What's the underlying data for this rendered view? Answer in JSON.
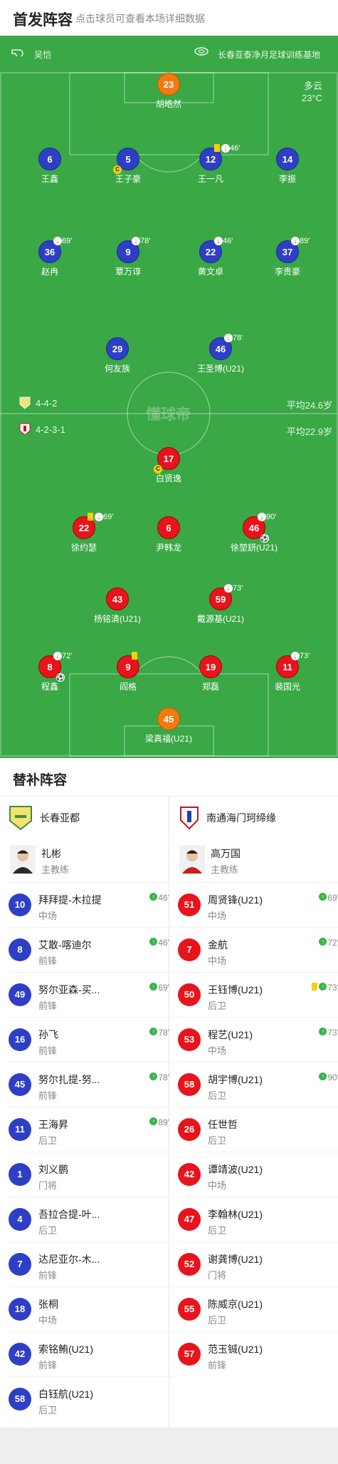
{
  "header": {
    "title": "首发阵容",
    "subtitle": "点击球员可查看本场详细数据"
  },
  "match_info": {
    "referee": "吴恺",
    "venue": "长春亚泰净月足球训练基地",
    "weather": "多云",
    "temperature": "23°C"
  },
  "watermark": "懂球帝",
  "home_formation": {
    "label": "4-4-2",
    "avg_age": "平均24.6岁"
  },
  "away_formation": {
    "label": "4-2-3-1",
    "avg_age": "平均22.9岁"
  },
  "home_lineup": [
    {
      "num": "23",
      "name": "胡皓然",
      "gk": true
    },
    {
      "num": "6",
      "name": "王鑫"
    },
    {
      "num": "5",
      "name": "王子豪",
      "captain": true
    },
    {
      "num": "12",
      "name": "王一凡",
      "yellow": true,
      "sub_out": "46'"
    },
    {
      "num": "14",
      "name": "李振"
    },
    {
      "num": "36",
      "name": "赵冉",
      "sub_out": "69'"
    },
    {
      "num": "9",
      "name": "覃万谆",
      "sub_out": "78'"
    },
    {
      "num": "22",
      "name": "黄文卓",
      "sub_out": "46'"
    },
    {
      "num": "37",
      "name": "李贵豪",
      "sub_out": "89'"
    },
    {
      "num": "29",
      "name": "何友族"
    },
    {
      "num": "46",
      "name": "王圣博(U21)",
      "sub_out": "78'"
    }
  ],
  "away_lineup": [
    {
      "num": "17",
      "name": "白贤逸",
      "captain": true
    },
    {
      "num": "22",
      "name": "徐约瑟",
      "yellow": true,
      "sub_out": "69'"
    },
    {
      "num": "6",
      "name": "尹韩龙"
    },
    {
      "num": "46",
      "name": "徐堃鈃(U21)",
      "sub_out": "90'",
      "goal": true
    },
    {
      "num": "43",
      "name": "杨铭清(U21)"
    },
    {
      "num": "59",
      "name": "戴源基(U21)",
      "sub_out": "73'"
    },
    {
      "num": "8",
      "name": "程鑫",
      "sub_out": "72'",
      "goal": true
    },
    {
      "num": "9",
      "name": "阎格",
      "yellow": true
    },
    {
      "num": "19",
      "name": "郑磊"
    },
    {
      "num": "11",
      "name": "裴国光",
      "sub_out": "73'"
    },
    {
      "num": "45",
      "name": "梁真福(U21)",
      "gk": true
    }
  ],
  "subs_title": "替补阵容",
  "home_team": {
    "name": "长春亚都",
    "coach": "礼彬",
    "coach_role": "主教练"
  },
  "away_team": {
    "name": "南通海门珂缔缘",
    "coach": "高万国",
    "coach_role": "主教练"
  },
  "home_subs": [
    {
      "num": "10",
      "name": "拜拜提-木拉提",
      "pos": "中场",
      "in": "46'"
    },
    {
      "num": "8",
      "name": "艾散-喀迪尔",
      "pos": "前锋",
      "in": "46'"
    },
    {
      "num": "49",
      "name": "努尔亚森-买...",
      "pos": "前锋",
      "in": "69'"
    },
    {
      "num": "16",
      "name": "孙飞",
      "pos": "前锋",
      "in": "78'"
    },
    {
      "num": "45",
      "name": "努尔扎提-努...",
      "pos": "前锋",
      "in": "78'"
    },
    {
      "num": "11",
      "name": "王海昇",
      "pos": "后卫",
      "in": "89'"
    },
    {
      "num": "1",
      "name": "刘义鹏",
      "pos": "门将"
    },
    {
      "num": "4",
      "name": "吾拉合提-叶...",
      "pos": "后卫"
    },
    {
      "num": "7",
      "name": "达尼亚尔-木...",
      "pos": "前锋"
    },
    {
      "num": "18",
      "name": "张桐",
      "pos": "中场"
    },
    {
      "num": "42",
      "name": "索铭鲔(U21)",
      "pos": "前锋"
    },
    {
      "num": "58",
      "name": "白钰航(U21)",
      "pos": "后卫"
    }
  ],
  "away_subs": [
    {
      "num": "51",
      "name": "周贤锋(U21)",
      "pos": "中场",
      "in": "69'"
    },
    {
      "num": "7",
      "name": "金航",
      "pos": "中场",
      "in": "72'"
    },
    {
      "num": "50",
      "name": "王钰博(U21)",
      "pos": "后卫",
      "in": "73'",
      "yellow": true
    },
    {
      "num": "53",
      "name": "程艺(U21)",
      "pos": "中场",
      "in": "73'"
    },
    {
      "num": "58",
      "name": "胡宇博(U21)",
      "pos": "后卫",
      "in": "90'"
    },
    {
      "num": "26",
      "name": "任世哲",
      "pos": "后卫"
    },
    {
      "num": "42",
      "name": "谭靖波(U21)",
      "pos": "中场"
    },
    {
      "num": "47",
      "name": "李翰林(U21)",
      "pos": "后卫"
    },
    {
      "num": "52",
      "name": "谢龚博(U21)",
      "pos": "门将"
    },
    {
      "num": "55",
      "name": "陈威京(U21)",
      "pos": "后卫"
    },
    {
      "num": "57",
      "name": "范玉铖(U21)",
      "pos": "前锋"
    }
  ],
  "colors": {
    "pitch": "#39a845",
    "home": "#2e3fc6",
    "away": "#e8141c",
    "goalkeeper": "#f27a10",
    "sub_in": "#35b54a"
  }
}
